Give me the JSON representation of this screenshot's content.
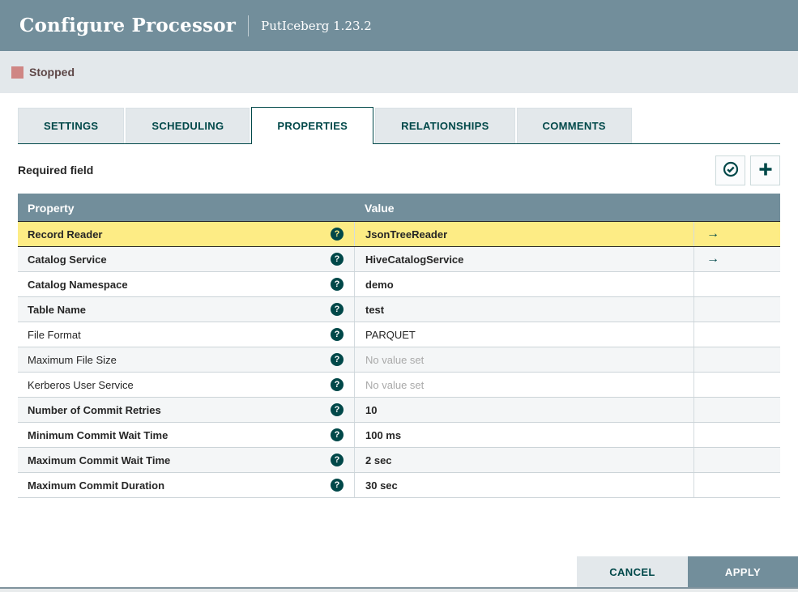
{
  "header": {
    "title": "Configure Processor",
    "subtitle": "PutIceberg 1.23.2"
  },
  "status": {
    "label": "Stopped"
  },
  "tabs": [
    {
      "label": "SETTINGS",
      "active": false
    },
    {
      "label": "SCHEDULING",
      "active": false
    },
    {
      "label": "PROPERTIES",
      "active": true
    },
    {
      "label": "RELATIONSHIPS",
      "active": false
    },
    {
      "label": "COMMENTS",
      "active": false
    }
  ],
  "toolbar": {
    "required_label": "Required field",
    "buttons": [
      {
        "name": "verify-properties-button",
        "icon": "check-circle-icon"
      },
      {
        "name": "add-property-button",
        "icon": "plus-icon"
      }
    ]
  },
  "table": {
    "columns": {
      "property": "Property",
      "value": "Value"
    },
    "rows": [
      {
        "property": "Record Reader",
        "value": "JsonTreeReader",
        "required": true,
        "selected": true,
        "goto": true,
        "empty": false
      },
      {
        "property": "Catalog Service",
        "value": "HiveCatalogService",
        "required": true,
        "selected": false,
        "goto": true,
        "empty": false
      },
      {
        "property": "Catalog Namespace",
        "value": "demo",
        "required": true,
        "selected": false,
        "goto": false,
        "empty": false
      },
      {
        "property": "Table Name",
        "value": "test",
        "required": true,
        "selected": false,
        "goto": false,
        "empty": false
      },
      {
        "property": "File Format",
        "value": "PARQUET",
        "required": false,
        "selected": false,
        "goto": false,
        "empty": false
      },
      {
        "property": "Maximum File Size",
        "value": "No value set",
        "required": false,
        "selected": false,
        "goto": false,
        "empty": true
      },
      {
        "property": "Kerberos User Service",
        "value": "No value set",
        "required": false,
        "selected": false,
        "goto": false,
        "empty": true
      },
      {
        "property": "Number of Commit Retries",
        "value": "10",
        "required": true,
        "selected": false,
        "goto": false,
        "empty": false
      },
      {
        "property": "Minimum Commit Wait Time",
        "value": "100 ms",
        "required": true,
        "selected": false,
        "goto": false,
        "empty": false
      },
      {
        "property": "Maximum Commit Wait Time",
        "value": "2 sec",
        "required": true,
        "selected": false,
        "goto": false,
        "empty": false
      },
      {
        "property": "Maximum Commit Duration",
        "value": "30 sec",
        "required": true,
        "selected": false,
        "goto": false,
        "empty": false
      }
    ]
  },
  "footer": {
    "cancel_label": "CANCEL",
    "apply_label": "APPLY"
  },
  "colors": {
    "header_bg": "#728E9B",
    "accent_teal": "#004849",
    "selected_row": "#FDEC85",
    "alt_row": "#F4F6F7",
    "status_stopped_icon": "#CF8684",
    "status_bar_bg": "#E3E8EB"
  }
}
